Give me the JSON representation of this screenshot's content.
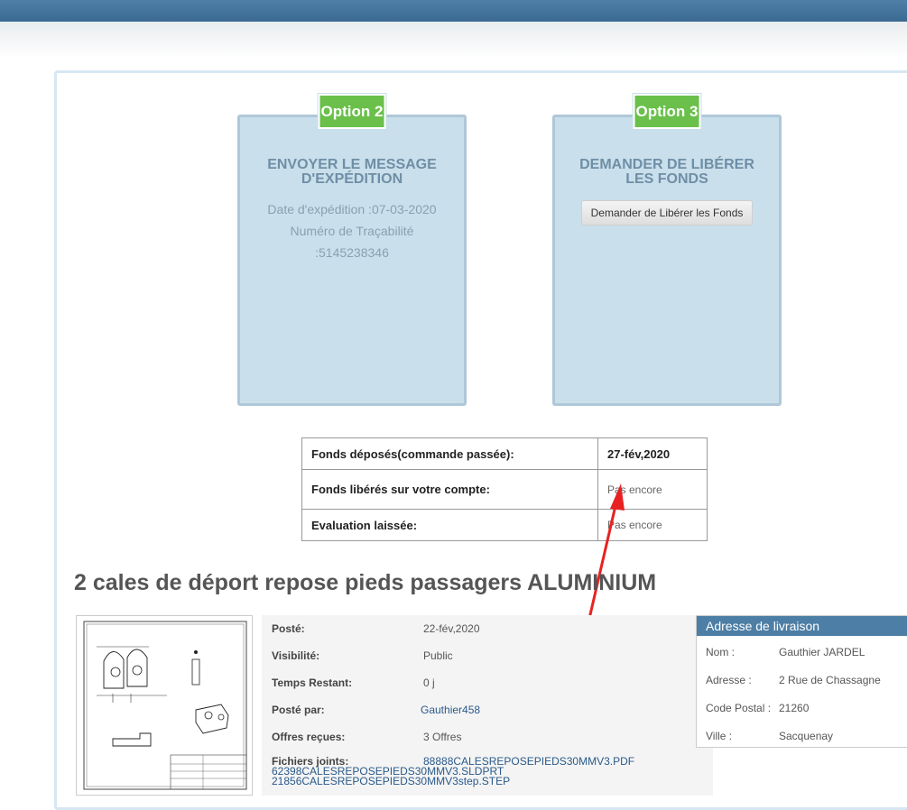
{
  "option2": {
    "badge": "Option 2",
    "title": "ENVOYER LE MESSAGE D'EXPÉDITION",
    "shipping_date": "Date d'expédition :07-03-2020",
    "tracking_label": "Numéro de Traçabilité",
    "tracking_number": ":5145238346"
  },
  "option3": {
    "badge": "Option 3",
    "title": "DEMANDER DE LIBÉRER LES FONDS",
    "button_label": "Demander de Libérer les Fonds"
  },
  "status_table": [
    {
      "label": "Fonds déposés(commande passée):",
      "value": "27-fév,2020"
    },
    {
      "label": "Fonds libérés sur votre compte:",
      "value": "Pas encore"
    },
    {
      "label": "Evaluation laissée:",
      "value": "Pas encore"
    }
  ],
  "product": {
    "title": "2 cales de déport repose pieds passagers ALUMINIUM",
    "details": [
      {
        "label": "Posté:",
        "value": "22-fév,2020"
      },
      {
        "label": "Visibilité:",
        "value": "Public"
      },
      {
        "label": "Temps Restant:",
        "value": "0 j"
      },
      {
        "label": "Posté par:",
        "value": "Gauthier458"
      },
      {
        "label": "Offres reçues:",
        "value": "3 Offres"
      }
    ],
    "files_label": "Fichiers joints:",
    "files": [
      "88888CALESREPOSEPIEDS30MMV3.PDF",
      "62398CALESREPOSEPIEDS30MMV3.SLDPRT",
      "21856CALESREPOSEPIEDS30MMV3step.STEP"
    ]
  },
  "address": {
    "header": "Adresse de livraison",
    "rows": [
      {
        "label": "Nom :",
        "value": "Gauthier JARDEL"
      },
      {
        "label": "Adresse :",
        "value": "2 Rue de Chassagne"
      },
      {
        "label": "Code Postal :",
        "value": "21260"
      },
      {
        "label": "Ville :",
        "value": "Sacquenay"
      }
    ]
  }
}
